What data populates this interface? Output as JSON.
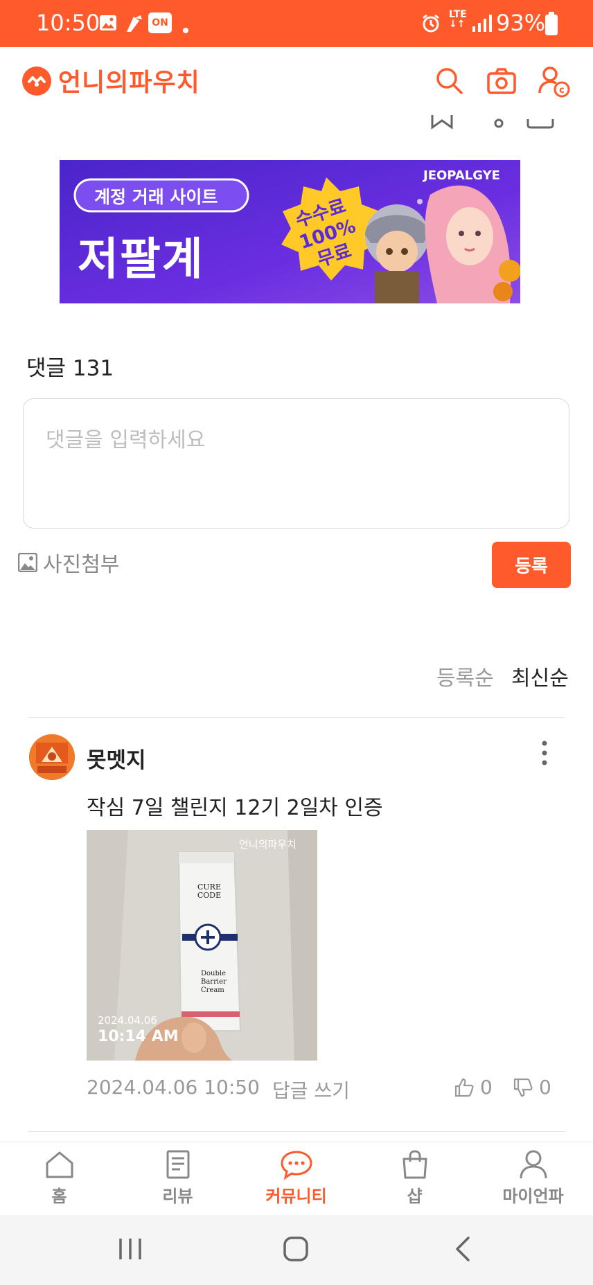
{
  "status_bar": {
    "time": "10:50",
    "battery": "93%",
    "network": "LTE",
    "icons": [
      "image-icon",
      "fan-icon",
      "on-badge-icon",
      "dot-icon",
      "alarm-icon",
      "lte-icon",
      "signal-icon",
      "battery-icon"
    ],
    "on_badge": "ON"
  },
  "header": {
    "brand_name": "언니의파우치",
    "actions": [
      "search-icon",
      "camera-icon",
      "user-coin-icon"
    ]
  },
  "banner": {
    "eyebrow": "계정 거래 사이트",
    "title": "저팔계",
    "badge": "수수료 100% 무료",
    "brand": "JEOPALGYE"
  },
  "comments": {
    "title": "댓글 131",
    "placeholder": "댓글을 입력하세요",
    "attach_label": "사진첨부",
    "submit_label": "등록",
    "sort_options": [
      "등록순",
      "최신순"
    ],
    "selected_sort": "최신순",
    "items": [
      {
        "author": "못멧지",
        "text": "작심 7일 챌린지 12기 2일차 인증",
        "photo_watermark": "언니의파우치",
        "photo_date": "2024.04.06",
        "photo_time": "10:14 AM",
        "photo_product": "CURE CODE Double Barrier Cream",
        "date": "2024.04.06 10:50",
        "reply_label": "답글 쓰기",
        "likes": "0",
        "dislikes": "0"
      }
    ]
  },
  "bottom_nav": {
    "items": [
      {
        "label": "홈",
        "icon": "home-icon"
      },
      {
        "label": "리뷰",
        "icon": "review-icon"
      },
      {
        "label": "커뮤니티",
        "icon": "community-icon"
      },
      {
        "label": "샵",
        "icon": "shop-icon"
      },
      {
        "label": "마이언파",
        "icon": "profile-icon"
      }
    ],
    "active": "커뮤니티"
  },
  "colors": {
    "accent": "#ff5a2c",
    "text": "#222222",
    "muted": "#999999",
    "placeholder": "#bdbdbd",
    "banner_bg": "#5b2bd9"
  }
}
